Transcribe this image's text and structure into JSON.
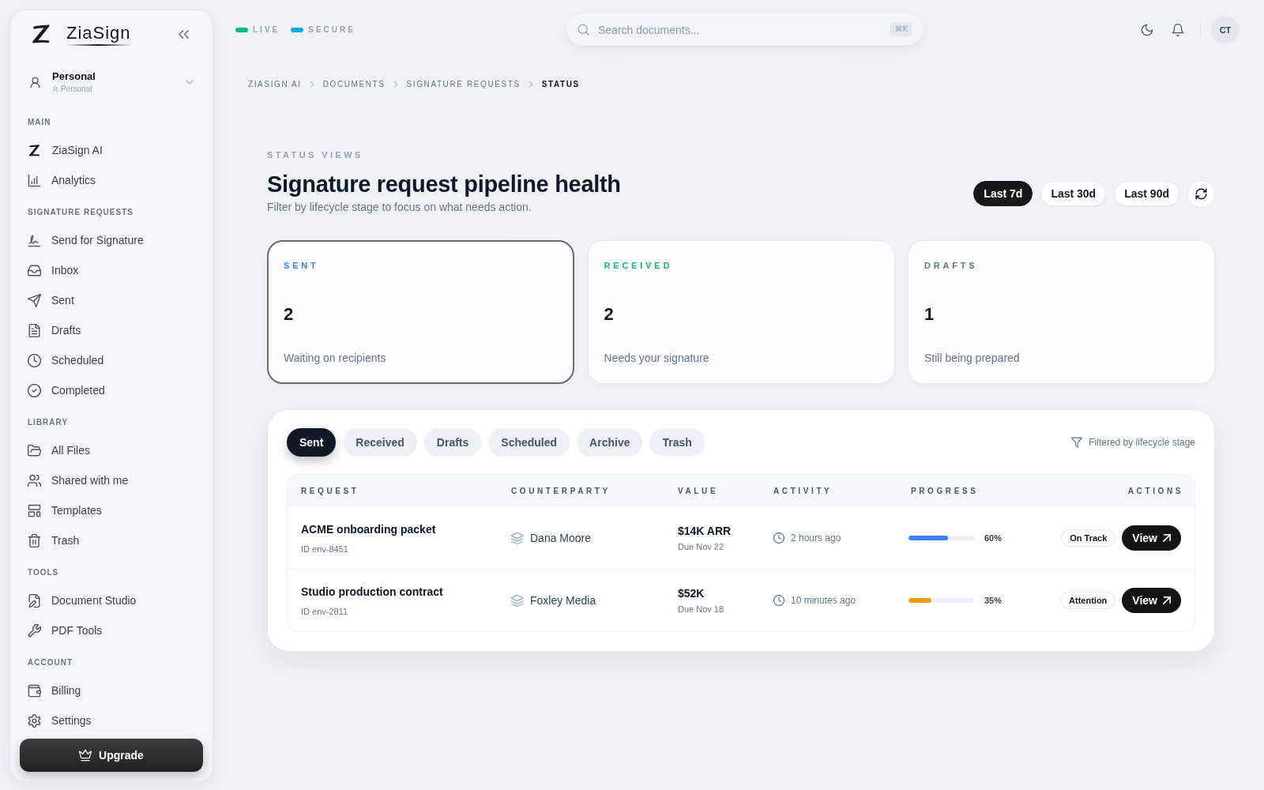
{
  "sidebar": {
    "brand": "ZiaSign",
    "workspace": {
      "name": "Personal",
      "type": "Personal"
    },
    "sections": [
      {
        "title": "MAIN",
        "items": [
          "ZiaSign AI",
          "Analytics"
        ]
      },
      {
        "title": "SIGNATURE REQUESTS",
        "items": [
          "Send for Signature",
          "Inbox",
          "Sent",
          "Drafts",
          "Scheduled",
          "Completed"
        ]
      },
      {
        "title": "LIBRARY",
        "items": [
          "All Files",
          "Shared with me",
          "Templates",
          "Trash"
        ]
      },
      {
        "title": "TOOLS",
        "items": [
          "Document Studio",
          "PDF Tools"
        ]
      },
      {
        "title": "ACCOUNT",
        "items": [
          "Billing",
          "Settings"
        ]
      }
    ],
    "upgrade": "Upgrade"
  },
  "topbar": {
    "indicators": [
      {
        "label": "LIVE",
        "color": "#10b981"
      },
      {
        "label": "SECURE",
        "color": "#0ea5e9"
      }
    ],
    "search": {
      "placeholder": "Search documents...",
      "shortcut": "⌘K"
    },
    "avatar": "CT"
  },
  "breadcrumbs": [
    {
      "label": "ZIASIGN AI",
      "current": false
    },
    {
      "label": "DOCUMENTS",
      "current": false
    },
    {
      "label": "SIGNATURE REQUESTS",
      "current": false
    },
    {
      "label": "STATUS",
      "current": true
    }
  ],
  "header": {
    "eyebrow": "STATUS VIEWS",
    "title": "Signature request pipeline health",
    "subtitle": "Filter by lifecycle stage to focus on what needs action.",
    "ranges": [
      {
        "label": "Last 7d",
        "selected": true
      },
      {
        "label": "Last 30d",
        "selected": false
      },
      {
        "label": "Last 90d",
        "selected": false
      }
    ]
  },
  "stat_cards": [
    {
      "label": "SENT",
      "color": "#3b82f6",
      "value": "2",
      "caption": "Waiting on recipients",
      "selected": true
    },
    {
      "label": "RECEIVED",
      "color": "#10b981",
      "value": "2",
      "caption": "Needs your signature",
      "selected": false
    },
    {
      "label": "DRAFTS",
      "color": "#64748b",
      "value": "1",
      "caption": "Still being prepared",
      "selected": false
    }
  ],
  "requests": {
    "tabs": [
      {
        "label": "Sent",
        "selected": true
      },
      {
        "label": "Received",
        "selected": false
      },
      {
        "label": "Drafts",
        "selected": false
      },
      {
        "label": "Scheduled",
        "selected": false
      },
      {
        "label": "Archive",
        "selected": false
      },
      {
        "label": "Trash",
        "selected": false
      }
    ],
    "filter_note": "Filtered by lifecycle stage",
    "columns": [
      "REQUEST",
      "COUNTERPARTY",
      "VALUE",
      "ACTIVITY",
      "PROGRESS",
      "ACTIONS"
    ],
    "rows": [
      {
        "title": "ACME onboarding packet",
        "id": "ID env-8451",
        "counterparty": "Dana Moore",
        "value": "$14K ARR",
        "due": "Due Nov 22",
        "activity": "2 hours ago",
        "progress": {
          "level": 0.6,
          "reading": "60%",
          "color": "#3b82f6"
        },
        "status": "On Track",
        "action": "View"
      },
      {
        "title": "Studio production contract",
        "id": "ID env-2811",
        "counterparty": "Foxley Media",
        "value": "$52K",
        "due": "Due Nov 18",
        "activity": "10 minutes ago",
        "progress": {
          "level": 0.35,
          "reading": "35%",
          "color": "#f59e0b"
        },
        "status": "Attention",
        "action": "View"
      }
    ]
  }
}
